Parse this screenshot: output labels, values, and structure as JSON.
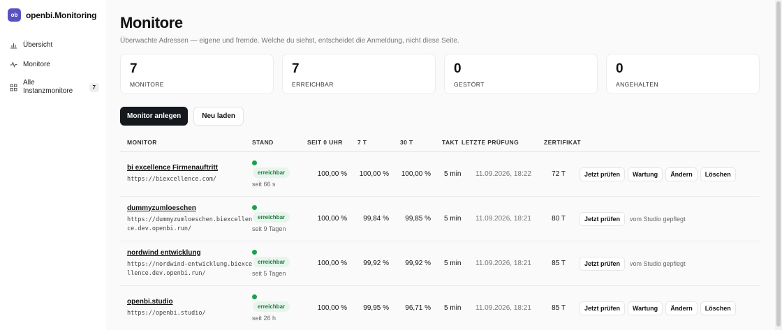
{
  "brand": {
    "logo": "ob",
    "name": "openbi.Monitoring"
  },
  "sidebar": {
    "items": [
      {
        "label": "Übersicht",
        "icon": "bar-chart-icon"
      },
      {
        "label": "Monitore",
        "icon": "pulse-icon"
      },
      {
        "label_line1": "Alle",
        "label_line2": "Instanzmonitore",
        "icon": "grid-icon",
        "badge": "7"
      }
    ]
  },
  "page": {
    "title": "Monitore",
    "subtitle": "Überwachte Adressen — eigene und fremde. Welche du siehst, entscheidet die Anmeldung, nicht diese Seite."
  },
  "stats": [
    {
      "value": "7",
      "label": "MONITORE"
    },
    {
      "value": "7",
      "label": "ERREICHBAR"
    },
    {
      "value": "0",
      "label": "GESTÖRT"
    },
    {
      "value": "0",
      "label": "ANGEHALTEN"
    }
  ],
  "actions": {
    "create": "Monitor anlegen",
    "reload": "Neu laden"
  },
  "table": {
    "headers": {
      "monitor": "MONITOR",
      "stand": "STAND",
      "seit0": "SEIT 0 UHR",
      "t7": "7 T",
      "t30": "30 T",
      "takt": "TAKT",
      "last": "LETZTE PRÜFUNG",
      "cert": "ZERTIFIKAT"
    },
    "rows": [
      {
        "name": "bi excellence Firmenauftritt",
        "url": "https://biexcellence.com/",
        "status": "erreichbar",
        "since": "seit 66 s",
        "today": "100,00 %",
        "d7": "100,00 %",
        "d30": "100,00 %",
        "takt": "5 min",
        "last": "11.09.2026, 18:22",
        "cert": "72 T",
        "check": "Jetzt prüfen",
        "maint": "Wartung",
        "edit": "Ändern",
        "del": "Löschen"
      },
      {
        "name": "dummyzumloeschen",
        "url": "https://dummyzumloeschen.biexcellence.dev.openbi.run/",
        "status": "erreichbar",
        "since": "seit 9 Tagen",
        "today": "100,00 %",
        "d7": "99,84 %",
        "d30": "99,85 %",
        "takt": "5 min",
        "last": "11.09.2026, 18:21",
        "cert": "80 T",
        "check": "Jetzt prüfen",
        "note": "vom Studio gepflegt"
      },
      {
        "name": "nordwind entwicklung",
        "url": "https://nordwind-entwicklung.biexcellence.dev.openbi.run/",
        "status": "erreichbar",
        "since": "seit 5 Tagen",
        "today": "100,00 %",
        "d7": "99,92 %",
        "d30": "99,92 %",
        "takt": "5 min",
        "last": "11.09.2026, 18:21",
        "cert": "85 T",
        "check": "Jetzt prüfen",
        "note": "vom Studio gepflegt"
      },
      {
        "name": "openbi.studio",
        "url": "https://openbi.studio/",
        "status": "erreichbar",
        "since": "seit 26 h",
        "today": "100,00 %",
        "d7": "99,95 %",
        "d30": "96,71 %",
        "takt": "5 min",
        "last": "11.09.2026, 18:21",
        "cert": "85 T",
        "check": "Jetzt prüfen",
        "maint": "Wartung",
        "edit": "Ändern",
        "del": "Löschen"
      }
    ]
  }
}
